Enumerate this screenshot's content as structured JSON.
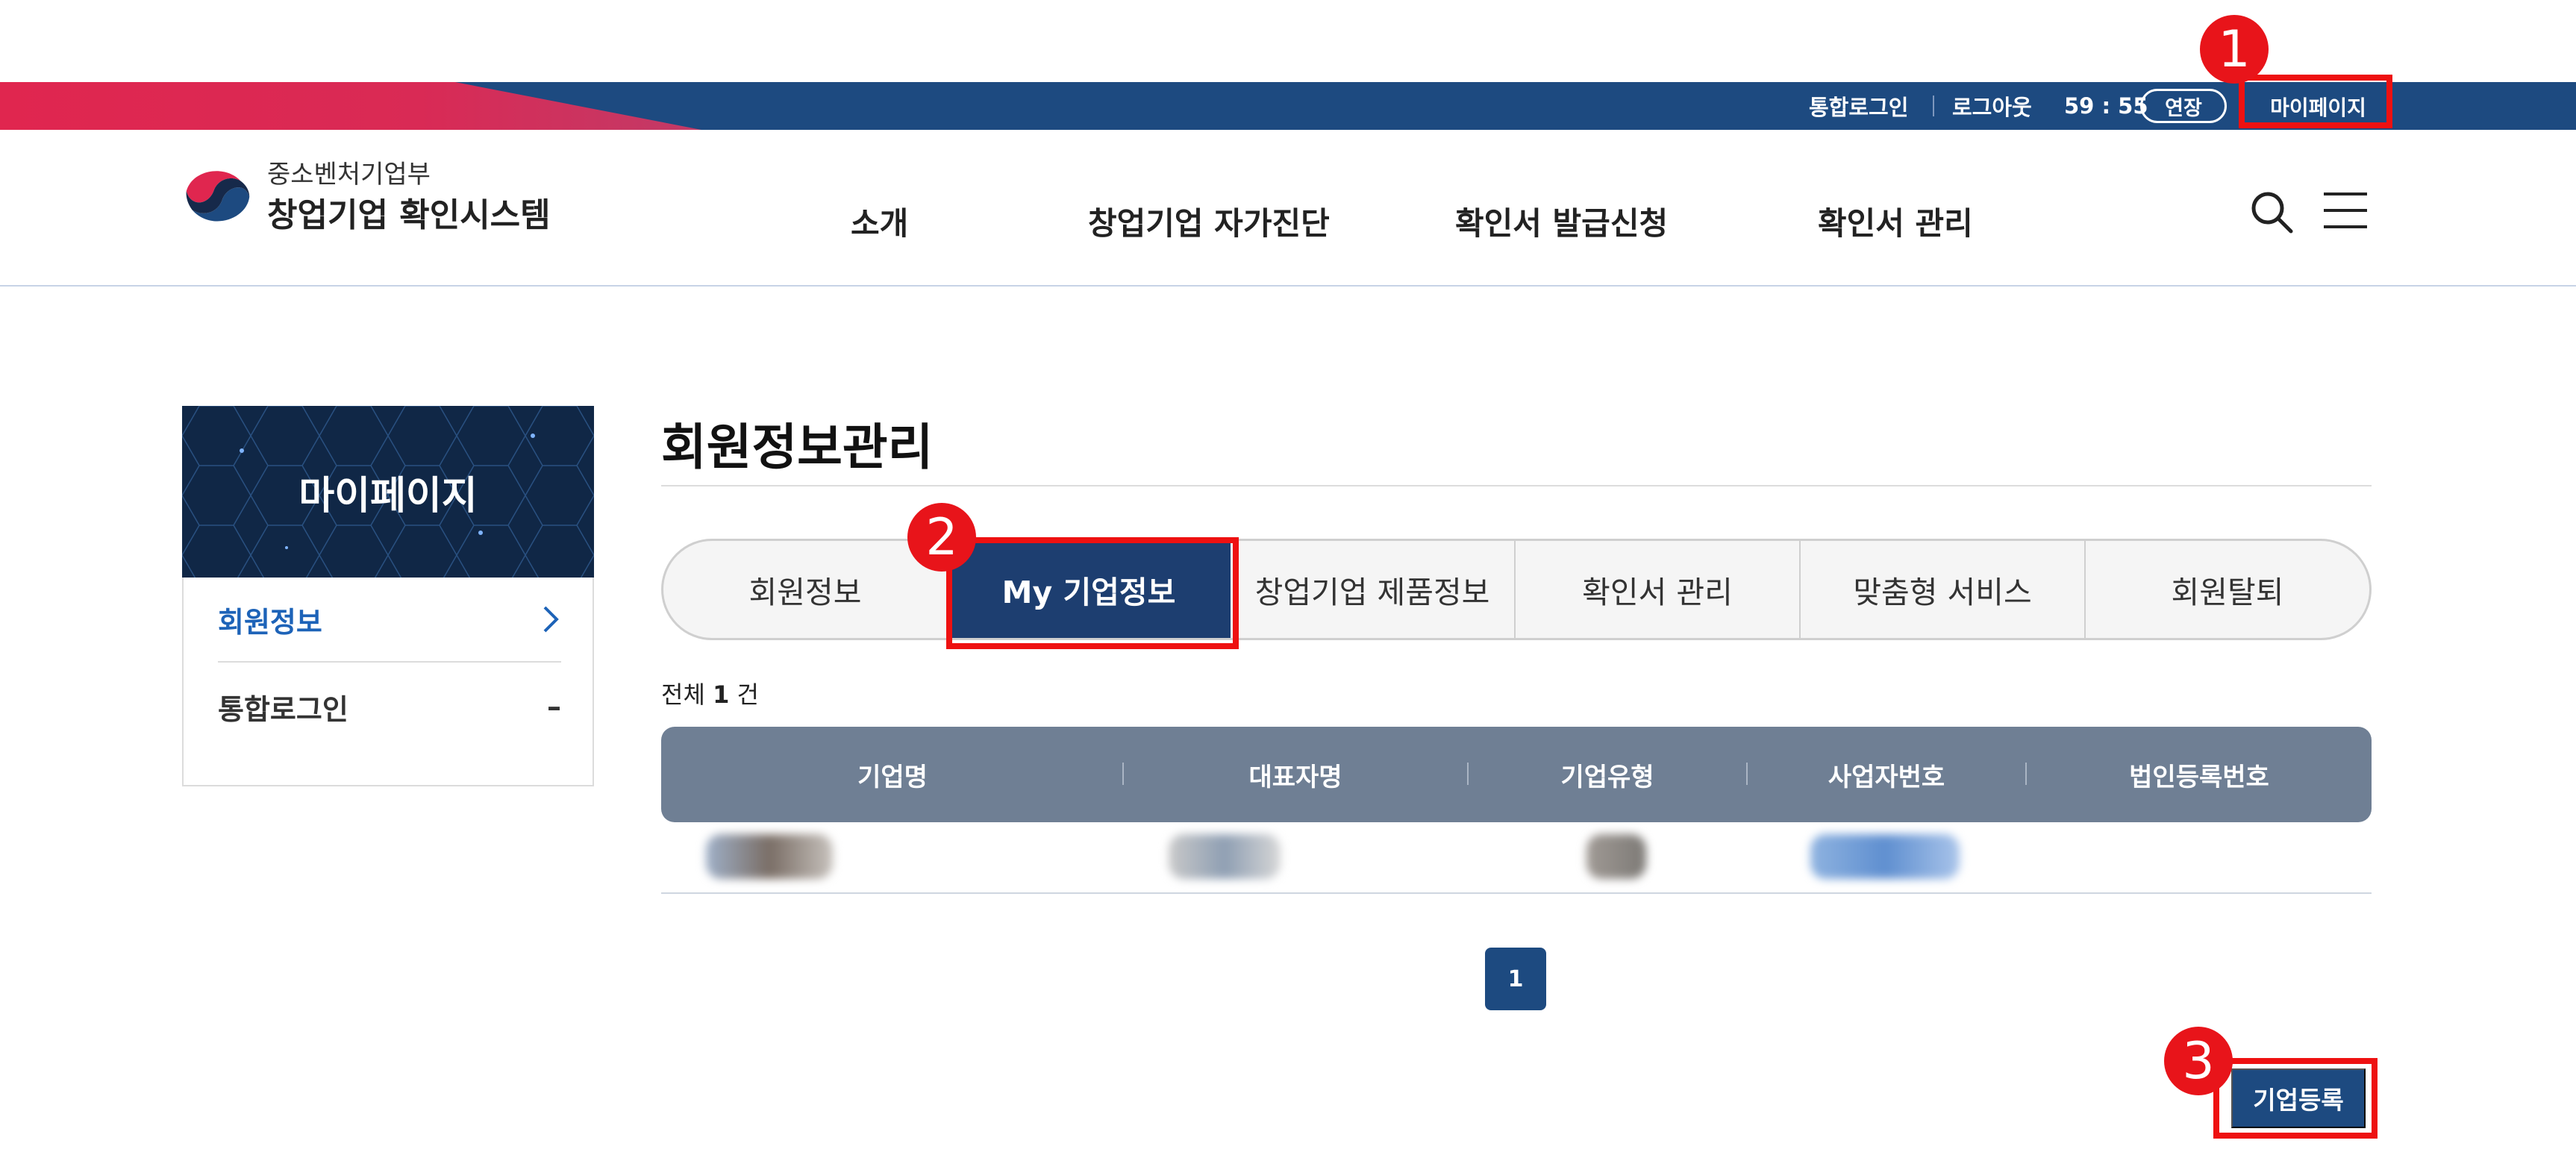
{
  "top_bar": {
    "integrated_login": "통합로그인",
    "logout": "로그아웃",
    "timer": "59 : 55",
    "extend": "연장",
    "mypage": "마이페이지"
  },
  "brand": {
    "ministry": "중소벤처기업부",
    "system": "창업기업 확인시스템"
  },
  "gnb": [
    "소개",
    "창업기업 자가진단",
    "확인서 발급신청",
    "확인서 관리"
  ],
  "sidebar": {
    "title": "마이페이지",
    "items": [
      {
        "label": "회원정보",
        "indicator": "›",
        "active": true
      },
      {
        "label": "통합로그인",
        "indicator": "–",
        "active": false
      }
    ]
  },
  "main": {
    "title": "회원정보관리",
    "tabs": [
      "회원정보",
      "My 기업정보",
      "창업기업 제품정보",
      "확인서 관리",
      "맞춤형 서비스",
      "회원탈퇴"
    ],
    "active_tab": "My 기업정보",
    "count": {
      "prefix": "전체",
      "value": "1",
      "suffix": "건"
    },
    "table": {
      "columns": [
        "기업명",
        "대표자명",
        "기업유형",
        "사업자번호",
        "법인등록번호"
      ]
    },
    "pagination": [
      "1"
    ],
    "register_button": "기업등록"
  },
  "annotations": [
    "1",
    "2",
    "3"
  ],
  "colors": {
    "navy": "#1d4a80",
    "accent_red": "#e0264f",
    "table_header": "#6f7f94",
    "highlight": "#ee1111"
  }
}
